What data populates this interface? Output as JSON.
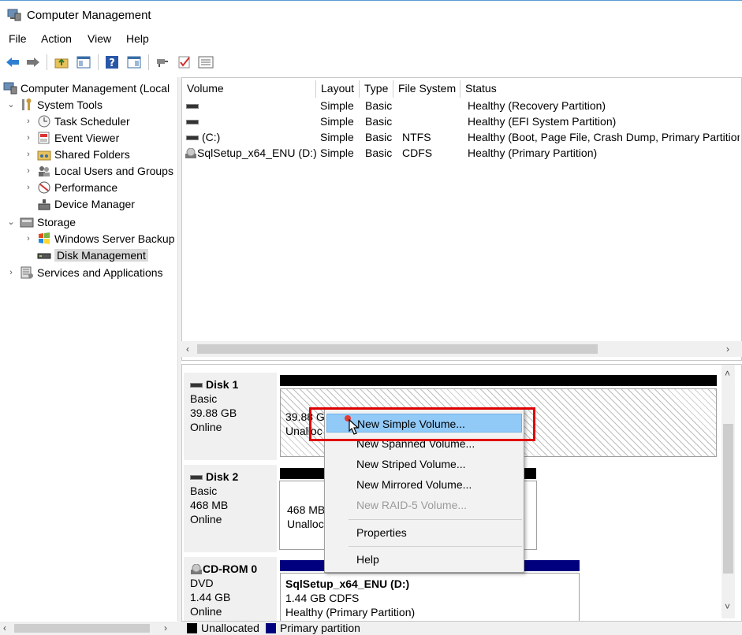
{
  "window": {
    "title": "Computer Management"
  },
  "menu": [
    "File",
    "Action",
    "View",
    "Help"
  ],
  "toolbar": {
    "buttons": [
      "back-icon",
      "forward-icon",
      "up-folder-icon",
      "show-hide-tree-icon",
      "help-icon",
      "properties-pane-icon",
      "connect-icon",
      "check-icon",
      "list-icon"
    ]
  },
  "tree": {
    "root": "Computer Management (Local",
    "system_tools": "System Tools",
    "task_scheduler": "Task Scheduler",
    "event_viewer": "Event Viewer",
    "shared_folders": "Shared Folders",
    "local_users": "Local Users and Groups",
    "performance": "Performance",
    "device_manager": "Device Manager",
    "storage": "Storage",
    "wsb": "Windows Server Backup",
    "disk_management": "Disk Management",
    "services_apps": "Services and Applications"
  },
  "volume_list": {
    "columns": [
      "Volume",
      "Layout",
      "Type",
      "File System",
      "Status"
    ],
    "rows": [
      {
        "volume": "",
        "layout": "Simple",
        "type": "Basic",
        "fs": "",
        "status": "Healthy (Recovery Partition)"
      },
      {
        "volume": "",
        "layout": "Simple",
        "type": "Basic",
        "fs": "",
        "status": "Healthy (EFI System Partition)"
      },
      {
        "volume": "(C:)",
        "layout": "Simple",
        "type": "Basic",
        "fs": "NTFS",
        "status": "Healthy (Boot, Page File, Crash Dump, Primary Partition"
      },
      {
        "volume": "SqlSetup_x64_ENU (D:)",
        "layout": "Simple",
        "type": "Basic",
        "fs": "CDFS",
        "status": "Healthy (Primary Partition)"
      }
    ]
  },
  "disks": {
    "disk1": {
      "name": "Disk 1",
      "kind": "Basic",
      "size": "39.88 GB",
      "state": "Online",
      "part_size": "39.88 GI",
      "part_status": "Unalloc"
    },
    "disk2": {
      "name": "Disk 2",
      "kind": "Basic",
      "size": "468 MB",
      "state": "Online",
      "part_size": "468 MB",
      "part_status": "Unalloc"
    },
    "cdrom0": {
      "name": "CD-ROM 0",
      "kind": "DVD",
      "size": "1.44 GB",
      "state": "Online",
      "part_name": "SqlSetup_x64_ENU  (D:)",
      "part_size": "1.44 GB CDFS",
      "part_status": "Healthy (Primary Partition)"
    }
  },
  "legend": {
    "unallocated": "Unallocated",
    "primary": "Primary partition"
  },
  "context_menu": {
    "new_simple": "New Simple Volume...",
    "new_spanned": "New Spanned Volume...",
    "new_striped": "New Striped Volume...",
    "new_mirrored": "New Mirrored Volume...",
    "new_raid5": "New RAID-5 Volume...",
    "properties": "Properties",
    "help": "Help"
  },
  "colors": {
    "primary": "#00007f",
    "unallocated": "#000000",
    "highlight": "#e00000",
    "hover": "#91c9f7"
  }
}
